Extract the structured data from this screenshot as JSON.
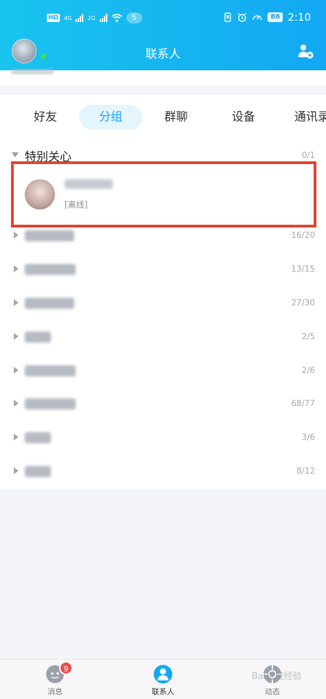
{
  "status_bar": {
    "hd": "HD",
    "net_4g": "4G",
    "net_2g": "2G",
    "badge": "5",
    "battery": "86",
    "time": "2:10"
  },
  "header": {
    "title": "联系人"
  },
  "tabs": [
    {
      "label": "好友",
      "active": false
    },
    {
      "label": "分组",
      "active": true
    },
    {
      "label": "群聊",
      "active": false
    },
    {
      "label": "设备",
      "active": false
    },
    {
      "label": "通讯录",
      "active": false
    }
  ],
  "special_group": {
    "title": "特别关心",
    "count": "0/1",
    "contact": {
      "name": "",
      "status": "[离线]"
    }
  },
  "groups": [
    {
      "count": "16/20"
    },
    {
      "count": "13/15"
    },
    {
      "count": "27/30"
    },
    {
      "count": "2/5"
    },
    {
      "count": "2/6"
    },
    {
      "count": "68/77"
    },
    {
      "count": "3/6"
    },
    {
      "count": "8/12"
    }
  ],
  "bottom_nav": {
    "messages": {
      "label": "消息",
      "badge": "9"
    },
    "contacts": {
      "label": "联系人"
    },
    "moments": {
      "label": "动态"
    }
  },
  "watermark": "Bai百度经验",
  "colors": {
    "header_start": "#19c4ef",
    "header_end": "#12a8f2",
    "accent": "#12a8f2",
    "highlight_border": "#e2432c",
    "badge": "#ef4a4a"
  }
}
